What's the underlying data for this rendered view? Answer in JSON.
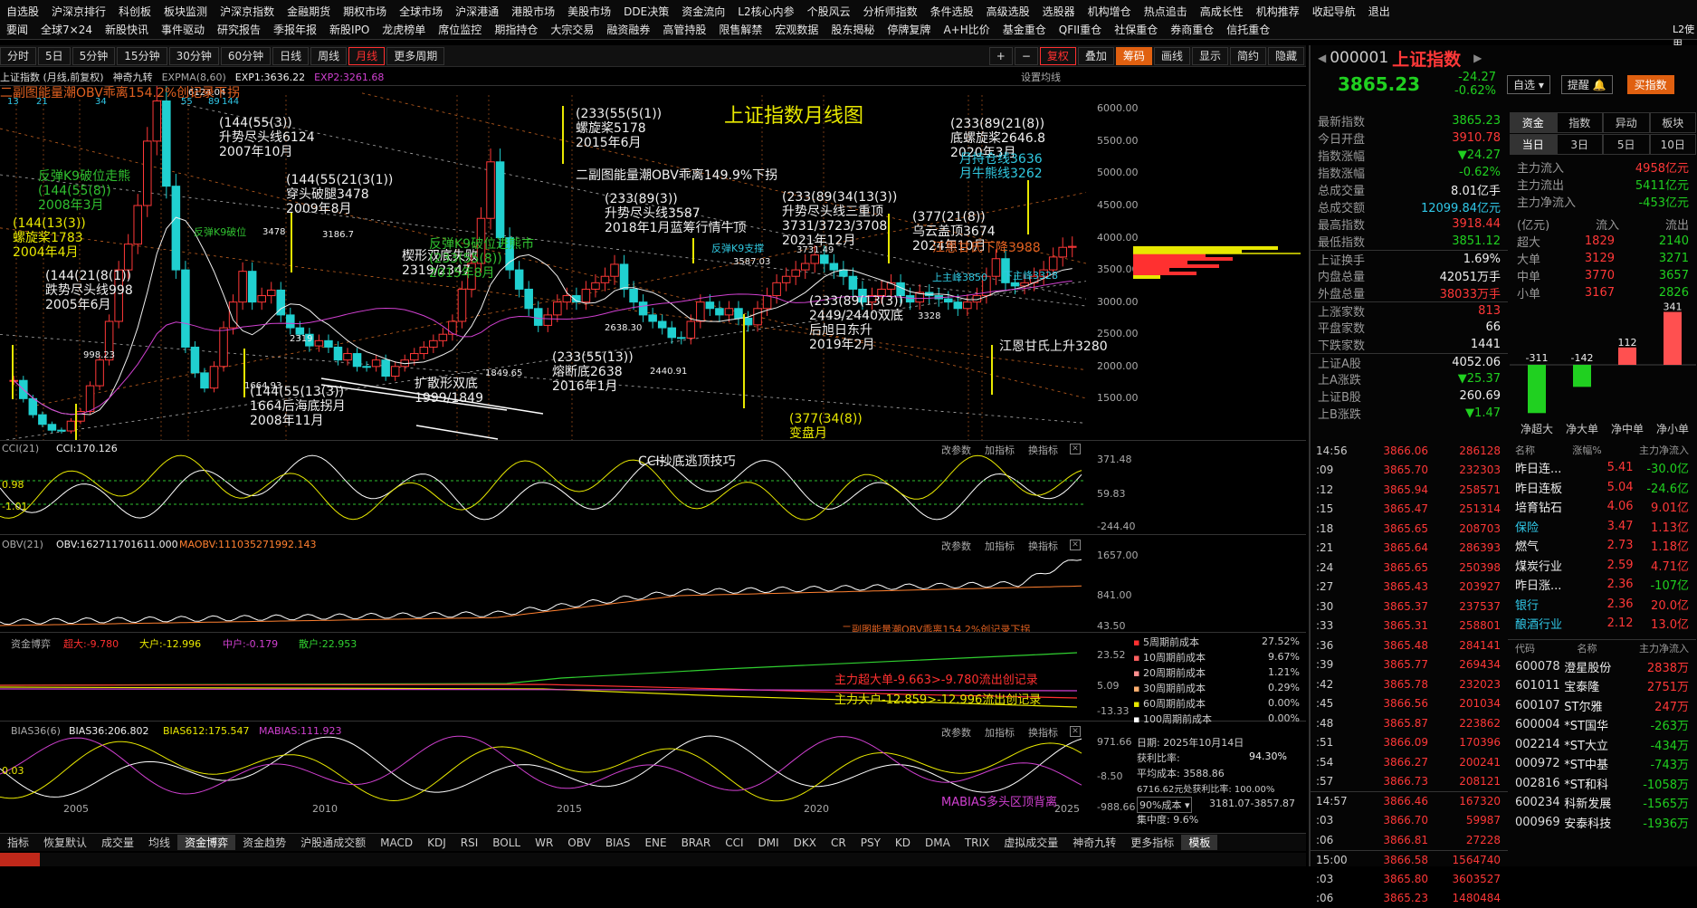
{
  "menu": {
    "row1": [
      "自选股",
      "沪深京排行",
      "科创板",
      "板块监测",
      "沪深京指数",
      "金融期货",
      "期权市场",
      "全球市场",
      "沪深港通",
      "港股市场",
      "美股市场",
      "DDE决策",
      "资金流向",
      "L2核心内参",
      "个股风云",
      "分析师指数",
      "条件选股",
      "高级选股",
      "选股器",
      "机构增仓",
      "热点追击",
      "高成长性",
      "机构推荐",
      "收起导航",
      "退出"
    ],
    "row2": [
      "要闻",
      "全球7×24",
      "新股快讯",
      "事件驱动",
      "研究报告",
      "季报年报",
      "新股IPO",
      "龙虎榜单",
      "席位监控",
      "期指持仓",
      "大宗交易",
      "融资融券",
      "高管持股",
      "限售解禁",
      "宏观数据",
      "股东揭秘",
      "停牌复牌",
      "A+H比价",
      "基金重仓",
      "QFII重仓",
      "社保重仓",
      "券商重仓",
      "信托重仓",
      "L2使用"
    ]
  },
  "toolbar": {
    "periods": [
      "分时",
      "5日",
      "5分钟",
      "15分钟",
      "30分钟",
      "60分钟",
      "日线",
      "周线",
      "月线",
      "更多周期"
    ],
    "selected": "月线",
    "right": [
      "复权",
      "叠加",
      "筹码",
      "画线",
      "显示",
      "简约",
      "隐藏"
    ],
    "highlight": "筹码"
  },
  "infobar": {
    "index": "上证指数 (月线,前复权)",
    "ind": "神奇九转",
    "expma": "EXPMA(8,60)",
    "exp1": "EXP1:3636.22",
    "exp2": "EXP2:3261.68",
    "settings": "设置均线"
  },
  "main_chart": {
    "title": "上证指数月线图",
    "price_axis": [
      "6000.00",
      "5500.00",
      "5000.00",
      "4500.00",
      "4000.00",
      "3500.00",
      "3000.00",
      "2500.00",
      "2000.00",
      "1500.00"
    ],
    "year_axis": [
      "2005",
      "2010",
      "2015",
      "2020",
      "2025"
    ],
    "annotations": [
      {
        "t": "6124.04",
        "c": "w"
      },
      {
        "t": "(144(55(3))\n升势尽头线6124\n2007年10月",
        "c": "w"
      },
      {
        "t": "反弹K9破位走熊\n(144(55(8))\n2008年3月",
        "c": "g"
      },
      {
        "t": "(144(13(3))\n螺旋桨1783\n2004年4月",
        "c": "y"
      },
      {
        "t": "(144(21(8(1))\n跌势尽头线998\n2005年6月",
        "c": "w"
      },
      {
        "t": "998.23",
        "c": "w"
      },
      {
        "t": "1664.93",
        "c": "w"
      },
      {
        "t": "(144(55(13(3))\n1664后海底拐月\n2008年11月",
        "c": "w"
      },
      {
        "t": "(144(55(21(3(1))\n穿头破腿3478\n2009年8月",
        "c": "w"
      },
      {
        "t": "反弹K9破位",
        "c": "g"
      },
      {
        "t": "3478",
        "c": "w"
      },
      {
        "t": "3186.7",
        "c": "w"
      },
      {
        "t": "楔形双底失败\n2319/2347",
        "c": "w"
      },
      {
        "t": "2319",
        "c": "w"
      },
      {
        "t": "扩散形双底\n1999/1849",
        "c": "w"
      },
      {
        "t": "1849.65",
        "c": "w"
      },
      {
        "t": "反弹K9破位进熊市\n(233(55(8))\n2015年8月",
        "c": "g"
      },
      {
        "t": "(233(55(5(1))\n螺旋桨5178\n2015年6月",
        "c": "w"
      },
      {
        "t": "二副图能量潮OBV乖离149.9%下拐",
        "c": "w"
      },
      {
        "t": "(233(89(3))\n升势尽头线3587\n2018年1月蓝筹行情牛顶",
        "c": "w"
      },
      {
        "t": "2638.30",
        "c": "w"
      },
      {
        "t": "(233(55(13))\n熔断底2638\n2016年1月",
        "c": "w"
      },
      {
        "t": "反弹K9支撑",
        "c": "c"
      },
      {
        "t": "3587.03",
        "c": "w"
      },
      {
        "t": "3731.49",
        "c": "w"
      },
      {
        "t": "(233(89(34(13(3))\n升势尽头线三重顶\n3731/3723/3708\n2021年12月",
        "c": "w"
      },
      {
        "t": "2440.91",
        "c": "w"
      },
      {
        "t": "(233(89(13(3))\n2449/2440双底\n后旭日东升\n2019年2月",
        "c": "w"
      },
      {
        "t": "(233(89(21(8))\n底螺旋桨2646.8\n2020年3月",
        "c": "w"
      },
      {
        "t": "月持仓线3636\n月牛熊线3262",
        "c": "c"
      },
      {
        "t": "(377(21(8))\n乌云盖顶3674\n2024年10月",
        "c": "w"
      },
      {
        "t": "江恩甘氏下降3988",
        "c": "o"
      },
      {
        "t": "上主峰3850",
        "c": "c"
      },
      {
        "t": "下主峰3328",
        "c": "c"
      },
      {
        "t": "3328",
        "c": "w"
      },
      {
        "t": "江恩甘氏上升3280",
        "c": "w"
      },
      {
        "t": "(377(34(8))\n变盘月\n2024年11月",
        "c": "y"
      },
      {
        "t": "二副图能量潮OBV乖离154.2%创记录下拐",
        "c": "o"
      }
    ],
    "nums_left": [
      "13",
      "21",
      "34",
      "55",
      "89",
      "144"
    ]
  },
  "cci": {
    "label": "CCI(21)",
    "value": "CCI:170.126",
    "title": "CCI抄底逃顶技巧",
    "axis": [
      "371.48",
      "59.83",
      "-244.40"
    ],
    "left": [
      "0.98",
      "-1.01"
    ]
  },
  "obv": {
    "label": "OBV(21)",
    "value": "OBV:162711701611.000",
    "maobv": "MAOBV:111035271992.143",
    "axis": [
      "1657.00",
      "841.00",
      "43.50"
    ],
    "note": "二副图能量潮OBV乖离154.2%创记录下拐"
  },
  "fund": {
    "label": "资金博弈",
    "super": "超大:-9.780",
    "big": "大户:-12.996",
    "mid": "中户:-0.179",
    "small": "散户:22.953",
    "axis": [
      "23.52",
      "5.09",
      "-13.33"
    ],
    "note1": "主力超大单-9.663>-9.780流出创记录",
    "note2": "主力大户-12.859>-12.996流出创记录"
  },
  "bias": {
    "label": "BIAS36(6)",
    "b36": "BIAS36:206.802",
    "b612": "BIAS612:175.547",
    "mabias": "MABIAS:111.923",
    "axis": [
      "971.66",
      "-8.50",
      "-988.66"
    ],
    "left": "0.03",
    "note": "MABIAS多头区顶背离"
  },
  "panel_buttons": [
    "改参数",
    "加指标",
    "换指标"
  ],
  "cost": {
    "rows": [
      {
        "label": "5周期前成本",
        "v": "27.52%",
        "c": "#ff3030"
      },
      {
        "label": "10周期前成本",
        "v": "9.67%",
        "c": "#ff6060"
      },
      {
        "label": "20周期前成本",
        "v": "1.21%",
        "c": "#ff9090"
      },
      {
        "label": "30周期前成本",
        "v": "0.29%",
        "c": "#ffb070"
      },
      {
        "label": "60周期前成本",
        "v": "0.00%",
        "c": "#e8e800"
      },
      {
        "label": "100周期前成本",
        "v": "0.00%",
        "c": "#ffffff"
      }
    ],
    "date": "日期: 2025年10月14日",
    "profit_label": "获利比率:",
    "profit": "94.30%",
    "avg": "平均成本: 3588.86",
    "price": "6716.62元处获利比率: 100.00%",
    "cost90": "90%成本",
    "range": "3181.07-3857.87",
    "conc": "集中度: 9.6%"
  },
  "bottom_tabs": [
    "指标",
    "恢复默认",
    "成交量",
    "均线",
    "资金博弈",
    "资金趋势",
    "沪股通成交额",
    "MACD",
    "KDJ",
    "RSI",
    "BOLL",
    "WR",
    "OBV",
    "BIAS",
    "ENE",
    "BRAR",
    "CCI",
    "DMI",
    "DKX",
    "CR",
    "PSY",
    "KD",
    "DMA",
    "TRIX",
    "虚拟成交量",
    "神奇九转",
    "更多指标",
    "模板"
  ],
  "quote": {
    "code": "000001",
    "name": "上证指数",
    "price": "3865.23",
    "chg": "-24.27",
    "pct": "-0.62%",
    "btn_watch": "自选",
    "btn_alert": "提醒",
    "btn_buy": "买指数",
    "stats": [
      {
        "k": "最新指数",
        "v": "3865.23",
        "c": "grn"
      },
      {
        "k": "今日开盘",
        "v": "3910.78",
        "c": "red"
      },
      {
        "k": "指数涨幅",
        "v": "▼24.27",
        "c": "grn"
      },
      {
        "k": "指数涨幅",
        "v": "-0.62%",
        "c": "grn"
      },
      {
        "k": "总成交量",
        "v": "8.01亿手",
        "c": "wht"
      },
      {
        "k": "总成交额",
        "v": "12099.84亿元",
        "c": "cy"
      },
      {
        "k": "最高指数",
        "v": "3918.44",
        "c": "red"
      },
      {
        "k": "最低指数",
        "v": "3851.12",
        "c": "grn"
      },
      {
        "k": "上证换手",
        "v": "1.69%",
        "c": "wht"
      },
      {
        "k": "内盘总量",
        "v": "42051万手",
        "c": "wht"
      },
      {
        "k": "外盘总量",
        "v": "38033万手",
        "c": "red"
      },
      {
        "k": "上涨家数",
        "v": "813",
        "c": "red"
      },
      {
        "k": "平盘家数",
        "v": "66",
        "c": "wht"
      },
      {
        "k": "下跌家数",
        "v": "1441",
        "c": "wht"
      },
      {
        "k": "上证A股",
        "v": "4052.06",
        "c": "wht"
      },
      {
        "k": "上A涨跌",
        "v": "▼25.37",
        "c": "grn"
      },
      {
        "k": "上证B股",
        "v": "260.69",
        "c": "wht"
      },
      {
        "k": "上B涨跌",
        "v": "▼1.47",
        "c": "grn"
      }
    ],
    "tabs1": [
      "资金",
      "指数",
      "异动",
      "板块"
    ],
    "tabs2": [
      "当日",
      "3日",
      "5日",
      "10日"
    ],
    "flow": [
      {
        "k": "主力流入",
        "v": "4958亿元",
        "c": "red"
      },
      {
        "k": "主力流出",
        "v": "5411亿元",
        "c": "grn"
      },
      {
        "k": "主力净流入",
        "v": "-453亿元",
        "c": "grn"
      }
    ],
    "flow_head": [
      "(亿元)",
      "流入",
      "流出"
    ],
    "flow_rows": [
      {
        "k": "超大",
        "in": "1829",
        "out": "2140"
      },
      {
        "k": "大单",
        "in": "3129",
        "out": "3271"
      },
      {
        "k": "中单",
        "in": "3770",
        "out": "3657"
      },
      {
        "k": "小单",
        "in": "3167",
        "out": "2826"
      }
    ],
    "net": [
      {
        "k": "净超大",
        "v": -311
      },
      {
        "k": "净大单",
        "v": -142
      },
      {
        "k": "净中单",
        "v": 112
      },
      {
        "k": "净小单",
        "v": 341
      }
    ],
    "ticks": [
      {
        "t": "14:56",
        "p": "3866.06",
        "v": "286128",
        "c": "red"
      },
      {
        "t": ":09",
        "p": "3865.70",
        "v": "232303",
        "c": "red"
      },
      {
        "t": ":12",
        "p": "3865.94",
        "v": "258571",
        "c": "red"
      },
      {
        "t": ":15",
        "p": "3865.47",
        "v": "251314",
        "c": "red"
      },
      {
        "t": ":18",
        "p": "3865.65",
        "v": "208703",
        "c": "red"
      },
      {
        "t": ":21",
        "p": "3865.64",
        "v": "286393",
        "c": "red"
      },
      {
        "t": ":24",
        "p": "3865.65",
        "v": "250398",
        "c": "red"
      },
      {
        "t": ":27",
        "p": "3865.43",
        "v": "203927",
        "c": "red"
      },
      {
        "t": ":30",
        "p": "3865.37",
        "v": "237537",
        "c": "red"
      },
      {
        "t": ":33",
        "p": "3865.31",
        "v": "258801",
        "c": "red"
      },
      {
        "t": ":36",
        "p": "3865.48",
        "v": "284141",
        "c": "red"
      },
      {
        "t": ":39",
        "p": "3865.77",
        "v": "269434",
        "c": "red"
      },
      {
        "t": ":42",
        "p": "3865.78",
        "v": "232023",
        "c": "red"
      },
      {
        "t": ":45",
        "p": "3866.56",
        "v": "201034",
        "c": "red"
      },
      {
        "t": ":48",
        "p": "3865.87",
        "v": "223862",
        "c": "red"
      },
      {
        "t": ":51",
        "p": "3866.09",
        "v": "170396",
        "c": "red"
      },
      {
        "t": ":54",
        "p": "3866.27",
        "v": "200241",
        "c": "red"
      },
      {
        "t": ":57",
        "p": "3866.73",
        "v": "208121",
        "c": "red"
      },
      {
        "t": "14:57",
        "p": "3866.46",
        "v": "167320",
        "c": "red"
      },
      {
        "t": ":03",
        "p": "3866.70",
        "v": "59987",
        "c": "red"
      },
      {
        "t": ":06",
        "p": "3866.81",
        "v": "27228",
        "c": "red"
      },
      {
        "t": "15:00",
        "p": "3866.58",
        "v": "1564740",
        "c": "red"
      },
      {
        "t": ":03",
        "p": "3865.80",
        "v": "3603527",
        "c": "red"
      },
      {
        "t": ":06",
        "p": "3865.23",
        "v": "1480484",
        "c": "red"
      }
    ],
    "sector_head": [
      "名称",
      "涨幅%",
      "主力净流入"
    ],
    "sectors": [
      {
        "n": "昨日连...",
        "p": "5.41",
        "v": "-30.0亿"
      },
      {
        "n": "昨日连板",
        "p": "5.04",
        "v": "-24.6亿"
      },
      {
        "n": "培育钻石",
        "p": "4.06",
        "v": "9.01亿"
      },
      {
        "n": "保险",
        "p": "3.47",
        "v": "1.13亿"
      },
      {
        "n": "燃气",
        "p": "2.73",
        "v": "1.18亿"
      },
      {
        "n": "煤炭行业",
        "p": "2.59",
        "v": "4.71亿"
      },
      {
        "n": "昨日涨...",
        "p": "2.36",
        "v": "-107亿"
      },
      {
        "n": "银行",
        "p": "2.36",
        "v": "20.0亿"
      },
      {
        "n": "酿酒行业",
        "p": "2.12",
        "v": "13.0亿"
      }
    ],
    "stock_head": [
      "代码",
      "名称",
      "主力净流入"
    ],
    "stocks": [
      {
        "c": "600078",
        "n": "澄星股份",
        "v": "2838万"
      },
      {
        "c": "601011",
        "n": "宝泰隆",
        "v": "2751万"
      },
      {
        "c": "600107",
        "n": "ST尔雅",
        "v": "247万"
      },
      {
        "c": "600004",
        "n": "*ST国华",
        "v": "-263万"
      },
      {
        "c": "002214",
        "n": "*ST大立",
        "v": "-434万"
      },
      {
        "c": "000972",
        "n": "*ST中基",
        "v": "-743万"
      },
      {
        "c": "002816",
        "n": "*ST和科",
        "v": "-1058万"
      },
      {
        "c": "600234",
        "n": "科新发展",
        "v": "-1565万"
      },
      {
        "c": "000969",
        "n": "安泰科技",
        "v": "-1936万"
      }
    ]
  },
  "colors": {
    "up": "#ff3838",
    "down": "#20d020",
    "accent": "#e06010"
  },
  "chart_data": {
    "type": "candlestick",
    "title": "上证指数月线图",
    "ylim": [
      900,
      6300
    ],
    "x": [
      "2005",
      "2010",
      "2015",
      "2020",
      "2025"
    ],
    "series": [
      {
        "name": "上证指数",
        "values": [
          1783,
          1500,
          1250,
          1100,
          1010,
          998,
          1150,
          1300,
          1700,
          2100,
          2700,
          3500,
          3900,
          4500,
          5500,
          6124,
          4800,
          3500,
          2300,
          1900,
          1664,
          2000,
          2600,
          3000,
          3478,
          3000,
          3100,
          3186,
          2800,
          2600,
          2500,
          2319,
          2400,
          2300,
          2100,
          2200,
          2000,
          1999,
          2100,
          1849,
          2000,
          2100,
          2200,
          2300,
          2400,
          2500,
          2700,
          3200,
          3600,
          4300,
          5178,
          4000,
          3500,
          3200,
          2900,
          2638,
          2800,
          3000,
          3100,
          3000,
          3200,
          3300,
          3400,
          3587,
          3200,
          3000,
          2800,
          2700,
          2600,
          2449,
          2440,
          2700,
          3000,
          2900,
          2800,
          2900,
          2750,
          2646,
          2900,
          3100,
          3300,
          3400,
          3500,
          3600,
          3731,
          3600,
          3500,
          3400,
          3200,
          3000,
          3100,
          3200,
          3300,
          3100,
          3000,
          3150,
          3100,
          3050,
          3000,
          2900,
          3000,
          3100,
          3400,
          3674,
          3300,
          3250,
          3300,
          3400,
          3500,
          3700,
          3850,
          3865
        ]
      }
    ]
  }
}
